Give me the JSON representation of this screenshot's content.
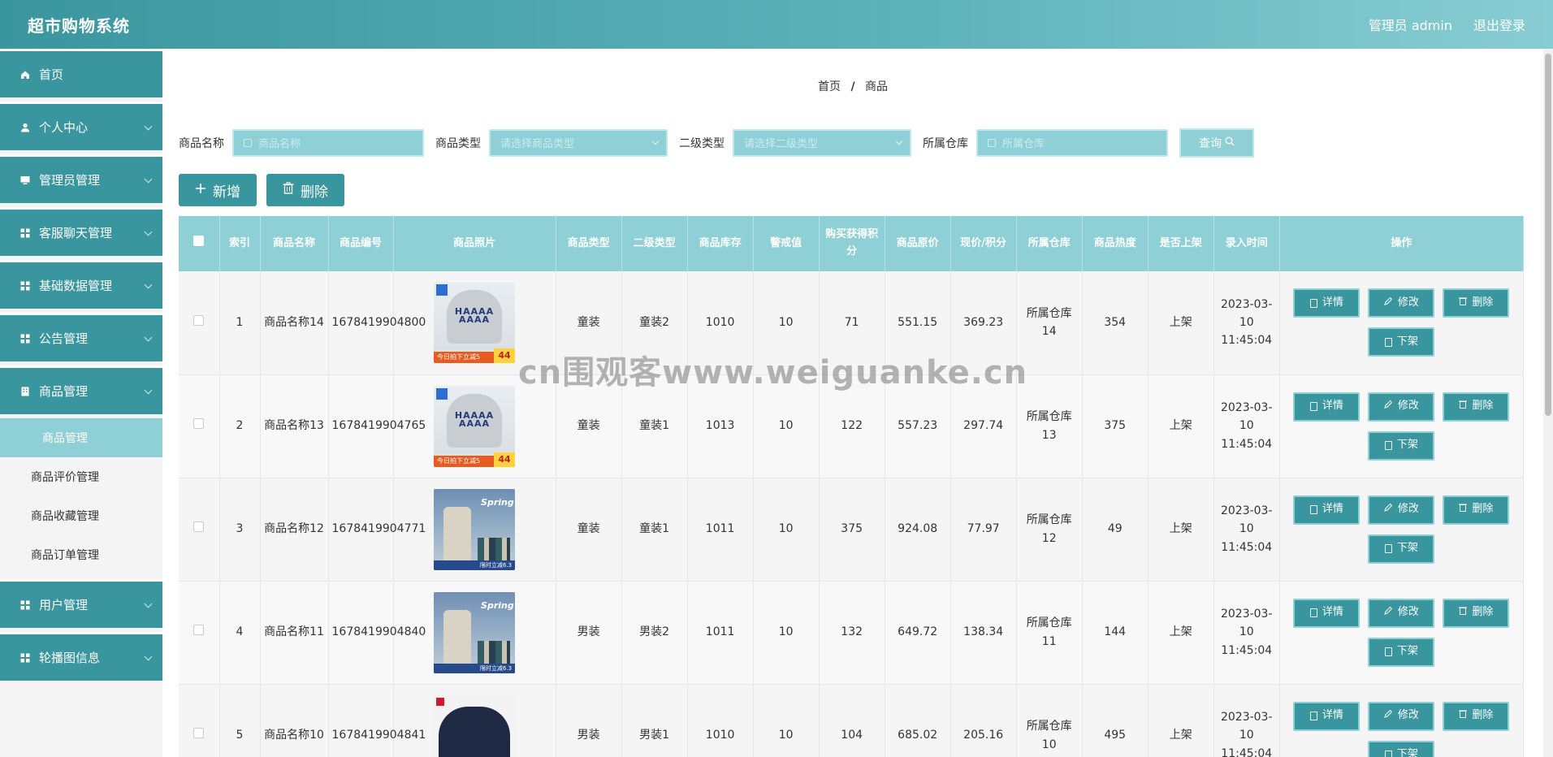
{
  "header": {
    "title": "超市购物系统",
    "user": "管理员 admin",
    "logout": "退出登录"
  },
  "sidebar": {
    "items": [
      {
        "label": "首页",
        "icon": "home-icon",
        "has_children": false
      },
      {
        "label": "个人中心",
        "icon": "user-icon",
        "has_children": true
      },
      {
        "label": "管理员管理",
        "icon": "monitor-icon",
        "has_children": true
      },
      {
        "label": "客服聊天管理",
        "icon": "grid-icon",
        "has_children": true
      },
      {
        "label": "基础数据管理",
        "icon": "grid-icon",
        "has_children": true
      },
      {
        "label": "公告管理",
        "icon": "grid-icon",
        "has_children": true
      },
      {
        "label": "商品管理",
        "icon": "building-icon",
        "has_children": true
      },
      {
        "label": "用户管理",
        "icon": "grid-icon",
        "has_children": true
      },
      {
        "label": "轮播图信息",
        "icon": "grid-icon",
        "has_children": true
      }
    ],
    "submenu": [
      "商品管理",
      "商品评价管理",
      "商品收藏管理",
      "商品订单管理"
    ]
  },
  "breadcrumb": {
    "home": "首页",
    "sep": "/",
    "current": "商品"
  },
  "search": {
    "name_label": "商品名称",
    "name_placeholder": "商品名称",
    "type_label": "商品类型",
    "type_placeholder": "请选择商品类型",
    "subtype_label": "二级类型",
    "subtype_placeholder": "请选择二级类型",
    "warehouse_label": "所属仓库",
    "warehouse_placeholder": "所属仓库",
    "query_label": "查询"
  },
  "toolbar": {
    "add_label": "新增",
    "delete_label": "删除"
  },
  "table": {
    "headers": [
      "",
      "索引",
      "商品名称",
      "商品编号",
      "商品照片",
      "商品类型",
      "二级类型",
      "商品库存",
      "警戒值",
      "购买获得积分",
      "商品原价",
      "现价/积分",
      "所属仓库",
      "商品热度",
      "是否上架",
      "录入时间",
      "操作"
    ],
    "actions": {
      "detail": "详情",
      "edit": "修改",
      "delete": "删除",
      "offline": "下架"
    },
    "rows": [
      {
        "index": "1",
        "name": "商品名称14",
        "code": "1678419904800",
        "photo": "gray-sweater",
        "type": "童装",
        "subtype": "童装2",
        "stock": "1010",
        "alert": "10",
        "points": "71",
        "orig_price": "551.15",
        "price": "369.23",
        "warehouse": "所属仓库14",
        "hot": "354",
        "on_sale": "上架",
        "time": "2023-03-10 11:45:04"
      },
      {
        "index": "2",
        "name": "商品名称13",
        "code": "1678419904765",
        "photo": "gray-sweater",
        "type": "童装",
        "subtype": "童装1",
        "stock": "1013",
        "alert": "10",
        "points": "122",
        "orig_price": "557.23",
        "price": "297.74",
        "warehouse": "所属仓库13",
        "hot": "375",
        "on_sale": "上架",
        "time": "2023-03-10 11:45:04"
      },
      {
        "index": "3",
        "name": "商品名称12",
        "code": "1678419904771",
        "photo": "blue-pants",
        "type": "童装",
        "subtype": "童装1",
        "stock": "1011",
        "alert": "10",
        "points": "375",
        "orig_price": "924.08",
        "price": "77.97",
        "warehouse": "所属仓库12",
        "hot": "49",
        "on_sale": "上架",
        "time": "2023-03-10 11:45:04"
      },
      {
        "index": "4",
        "name": "商品名称11",
        "code": "1678419904840",
        "photo": "blue-pants",
        "type": "男装",
        "subtype": "男装2",
        "stock": "1011",
        "alert": "10",
        "points": "132",
        "orig_price": "649.72",
        "price": "138.34",
        "warehouse": "所属仓库11",
        "hot": "144",
        "on_sale": "上架",
        "time": "2023-03-10 11:45:04"
      },
      {
        "index": "5",
        "name": "商品名称10",
        "code": "1678419904841",
        "photo": "navy-sweater",
        "type": "男装",
        "subtype": "男装1",
        "stock": "1010",
        "alert": "10",
        "points": "104",
        "orig_price": "685.02",
        "price": "205.16",
        "warehouse": "所属仓库10",
        "hot": "495",
        "on_sale": "上架",
        "time": "2023-03-10 11:45:04"
      }
    ]
  },
  "photo_text": {
    "gray_print": "HAAAA AAAA",
    "gray_badge": "今日拍下立减5",
    "gray_price": "44",
    "blue_title": "Spring",
    "blue_badge": "限时立减6.3"
  },
  "watermark": "cn围观客www.weiguanke.cn",
  "colors": {
    "primary": "#3a969e",
    "light": "#8ed0d6"
  }
}
